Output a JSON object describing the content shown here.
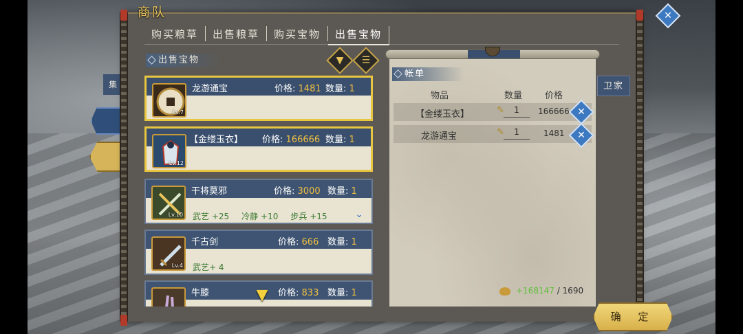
{
  "window": {
    "title": "商队"
  },
  "tabs": [
    {
      "label": "购买粮草"
    },
    {
      "label": "出售粮草"
    },
    {
      "label": "购买宝物"
    },
    {
      "label": "出售宝物"
    }
  ],
  "active_tab": "出售宝物",
  "sell_section": {
    "label": "出售宝物"
  },
  "side_tabs": {
    "collect": "集",
    "guard": "卫家"
  },
  "labels": {
    "price": "价格:",
    "qty": "数量:"
  },
  "items": [
    {
      "name": "龙游通宝",
      "price": "1481",
      "qty": "1",
      "level": "Lv.7",
      "selected": true,
      "stats": []
    },
    {
      "name": "【金缕玉衣】",
      "price": "166666",
      "qty": "1",
      "level": "Lv.12",
      "selected": true,
      "stats": []
    },
    {
      "name": "干将莫邪",
      "price": "3000",
      "qty": "1",
      "level": "Lv.10",
      "selected": false,
      "stats": [
        {
          "name": "武艺",
          "value": "+25"
        },
        {
          "name": "冷静",
          "value": "+10"
        },
        {
          "name": "步兵",
          "value": "+15"
        }
      ]
    },
    {
      "name": "千古剑",
      "price": "666",
      "qty": "1",
      "level": "Lv.4",
      "selected": false,
      "stats": [
        {
          "name": "武艺+",
          "value": "4"
        }
      ]
    },
    {
      "name": "牛膝",
      "price": "833",
      "qty": "1",
      "level": "",
      "selected": false,
      "stats": []
    }
  ],
  "ledger": {
    "label": "帐单",
    "columns": {
      "item": "物品",
      "qty": "数量",
      "price": "价格"
    },
    "rows": [
      {
        "name": "【金缕玉衣】",
        "qty": "1",
        "price": "166666"
      },
      {
        "name": "龙游通宝",
        "qty": "1",
        "price": "1481"
      }
    ],
    "money_have": "+168147",
    "money_sep": " / ",
    "money_cap": "1690"
  },
  "confirm_button": "确 定",
  "colors": {
    "gold": "#f0c040",
    "header_blue": "#3f5472",
    "green": "#5fbf3a"
  }
}
